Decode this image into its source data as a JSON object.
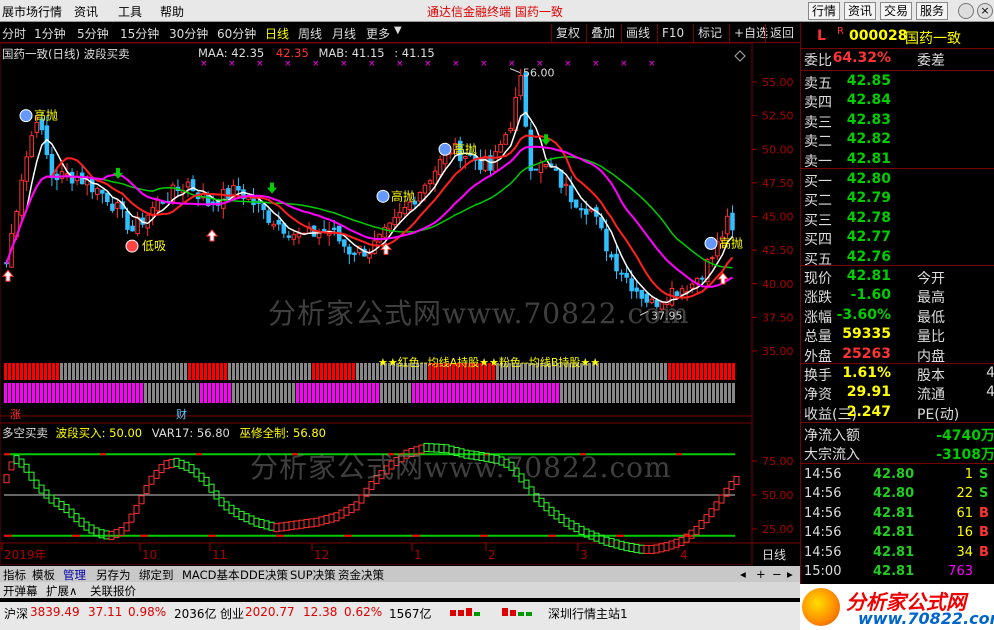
{
  "menubar": {
    "app_title": "展市场行情",
    "items": [
      "资讯",
      "工具",
      "帮助"
    ],
    "ticker": "通达信金融终端   国药一致",
    "buttons": [
      "行情",
      "资讯",
      "交易",
      "服务"
    ]
  },
  "toolbar": {
    "periods": [
      "分时",
      "1分钟",
      "5分钟",
      "15分钟",
      "30分钟",
      "60分钟",
      "日线",
      "周线",
      "月线",
      "更多"
    ],
    "active": "日线",
    "right_buttons": [
      "复权",
      "叠加",
      "画线",
      "F10",
      "标记",
      "+自选",
      "返回"
    ]
  },
  "chart": {
    "title": "国药一致(日线) 波段买卖",
    "maa_label": "MAA: 42.35",
    "maa_extra": "42.35",
    "mab_label": "MAB: 41.15",
    "mab_extra": ": 41.15",
    "price_ticks": [
      "55.00",
      "52.50",
      "50.00",
      "47.50",
      "45.00",
      "42.50",
      "40.00",
      "37.50",
      "35.00"
    ],
    "high_label": "56.00",
    "low_label": "37.95",
    "watermark": "分析家公式网www.70822.com",
    "sell_labels": [
      "高抛",
      "高抛",
      "高抛",
      "高抛"
    ],
    "buy_label": "低吸",
    "band_label": "★★红色--均线A持股★★粉色--均线B持股★★",
    "zhang": "涨",
    "cai": "财",
    "colors": {
      "red": "#ff0000",
      "magenta": "#ff00ff",
      "green": "#00cc00",
      "white": "#ffffff",
      "yellow": "#ffff00"
    }
  },
  "indicator": {
    "title": "多空买卖",
    "v1": "波段买入: 50.00",
    "v2": "VAR17: 56.80",
    "v3": "巫修全制: 56.80",
    "ticks": [
      "75.00",
      "50.00",
      "25.00"
    ],
    "watermark": "分析家公式网www.70822.com"
  },
  "xaxis": {
    "labels": [
      "2019年",
      "10",
      "11",
      "12",
      "1",
      "2",
      "3",
      "4"
    ],
    "period": "日线"
  },
  "bottom_tabs": [
    "指标",
    "模板",
    "管理",
    "另存为",
    "绑定到",
    "MACD基本",
    "DDE决策",
    "SUP决策",
    "资金决策"
  ],
  "bottom_tabs2": [
    "开弹幕",
    "扩展∧",
    "关联报价"
  ],
  "right_panel": {
    "letter": "L",
    "code": "000028",
    "name": "国药一致",
    "weibi_label": "委比",
    "weibi": "64.32%",
    "weicha_label": "委差",
    "asks": [
      {
        "label": "卖五",
        "price": "42.85"
      },
      {
        "label": "卖四",
        "price": "42.84"
      },
      {
        "label": "卖三",
        "price": "42.83"
      },
      {
        "label": "卖二",
        "price": "42.82"
      },
      {
        "label": "卖一",
        "price": "42.81"
      }
    ],
    "bids": [
      {
        "label": "买一",
        "price": "42.80"
      },
      {
        "label": "买二",
        "price": "42.79"
      },
      {
        "label": "买三",
        "price": "42.78"
      },
      {
        "label": "买四",
        "price": "42.77"
      },
      {
        "label": "买五",
        "price": "42.76"
      }
    ],
    "stats": [
      {
        "l1": "现价",
        "v1": "42.81",
        "c1": "#00cc00",
        "l2": "今开",
        "v2": ""
      },
      {
        "l1": "涨跌",
        "v1": "-1.60",
        "c1": "#00cc00",
        "l2": "最高",
        "v2": ""
      },
      {
        "l1": "涨幅",
        "v1": "-3.60%",
        "c1": "#00cc00",
        "l2": "最低",
        "v2": ""
      },
      {
        "l1": "总量",
        "v1": "59335",
        "c1": "#ffff00",
        "l2": "量比",
        "v2": ""
      },
      {
        "l1": "外盘",
        "v1": "25263",
        "c1": "#ff3333",
        "l2": "内盘",
        "v2": ""
      }
    ],
    "stats2": [
      {
        "l1": "换手",
        "v1": "1.61%",
        "c1": "#ffff00",
        "l2": "股本",
        "v2": "4"
      },
      {
        "l1": "净资",
        "v1": "29.91",
        "c1": "#ffff00",
        "l2": "流通",
        "v2": "4"
      },
      {
        "l1": "收益(三)",
        "v1": "2.247",
        "c1": "#ffff00",
        "l2": "PE(动)",
        "v2": ""
      }
    ],
    "flows": [
      {
        "label": "净流入额",
        "value": "-4740万"
      },
      {
        "label": "大宗流入",
        "value": "-3108万"
      }
    ],
    "ticks": [
      {
        "time": "14:56",
        "price": "42.80",
        "vol": "1",
        "flag": "S"
      },
      {
        "time": "14:56",
        "price": "42.80",
        "vol": "22",
        "flag": "S"
      },
      {
        "time": "14:56",
        "price": "42.81",
        "vol": "61",
        "flag": "B"
      },
      {
        "time": "14:56",
        "price": "42.81",
        "vol": "16",
        "flag": "B"
      },
      {
        "time": "14:56",
        "price": "42.81",
        "vol": "34",
        "flag": "B"
      },
      {
        "time": "15:00",
        "price": "42.81",
        "vol": "763",
        "flag": ""
      }
    ]
  },
  "statusbar": {
    "sh_label": "沪深",
    "sh_value": "3839.49",
    "sh_change": "37.11",
    "sh_pct": "0.98%",
    "sh_amount": "2036亿",
    "cy_label": "创业",
    "cy_value": "2020.77",
    "cy_change": "12.38",
    "cy_pct": "0.62%",
    "cy_amount": "1567亿",
    "server": "深圳行情主站1"
  },
  "logo": {
    "text": "分析家公式网",
    "url": "www.70822.com"
  }
}
